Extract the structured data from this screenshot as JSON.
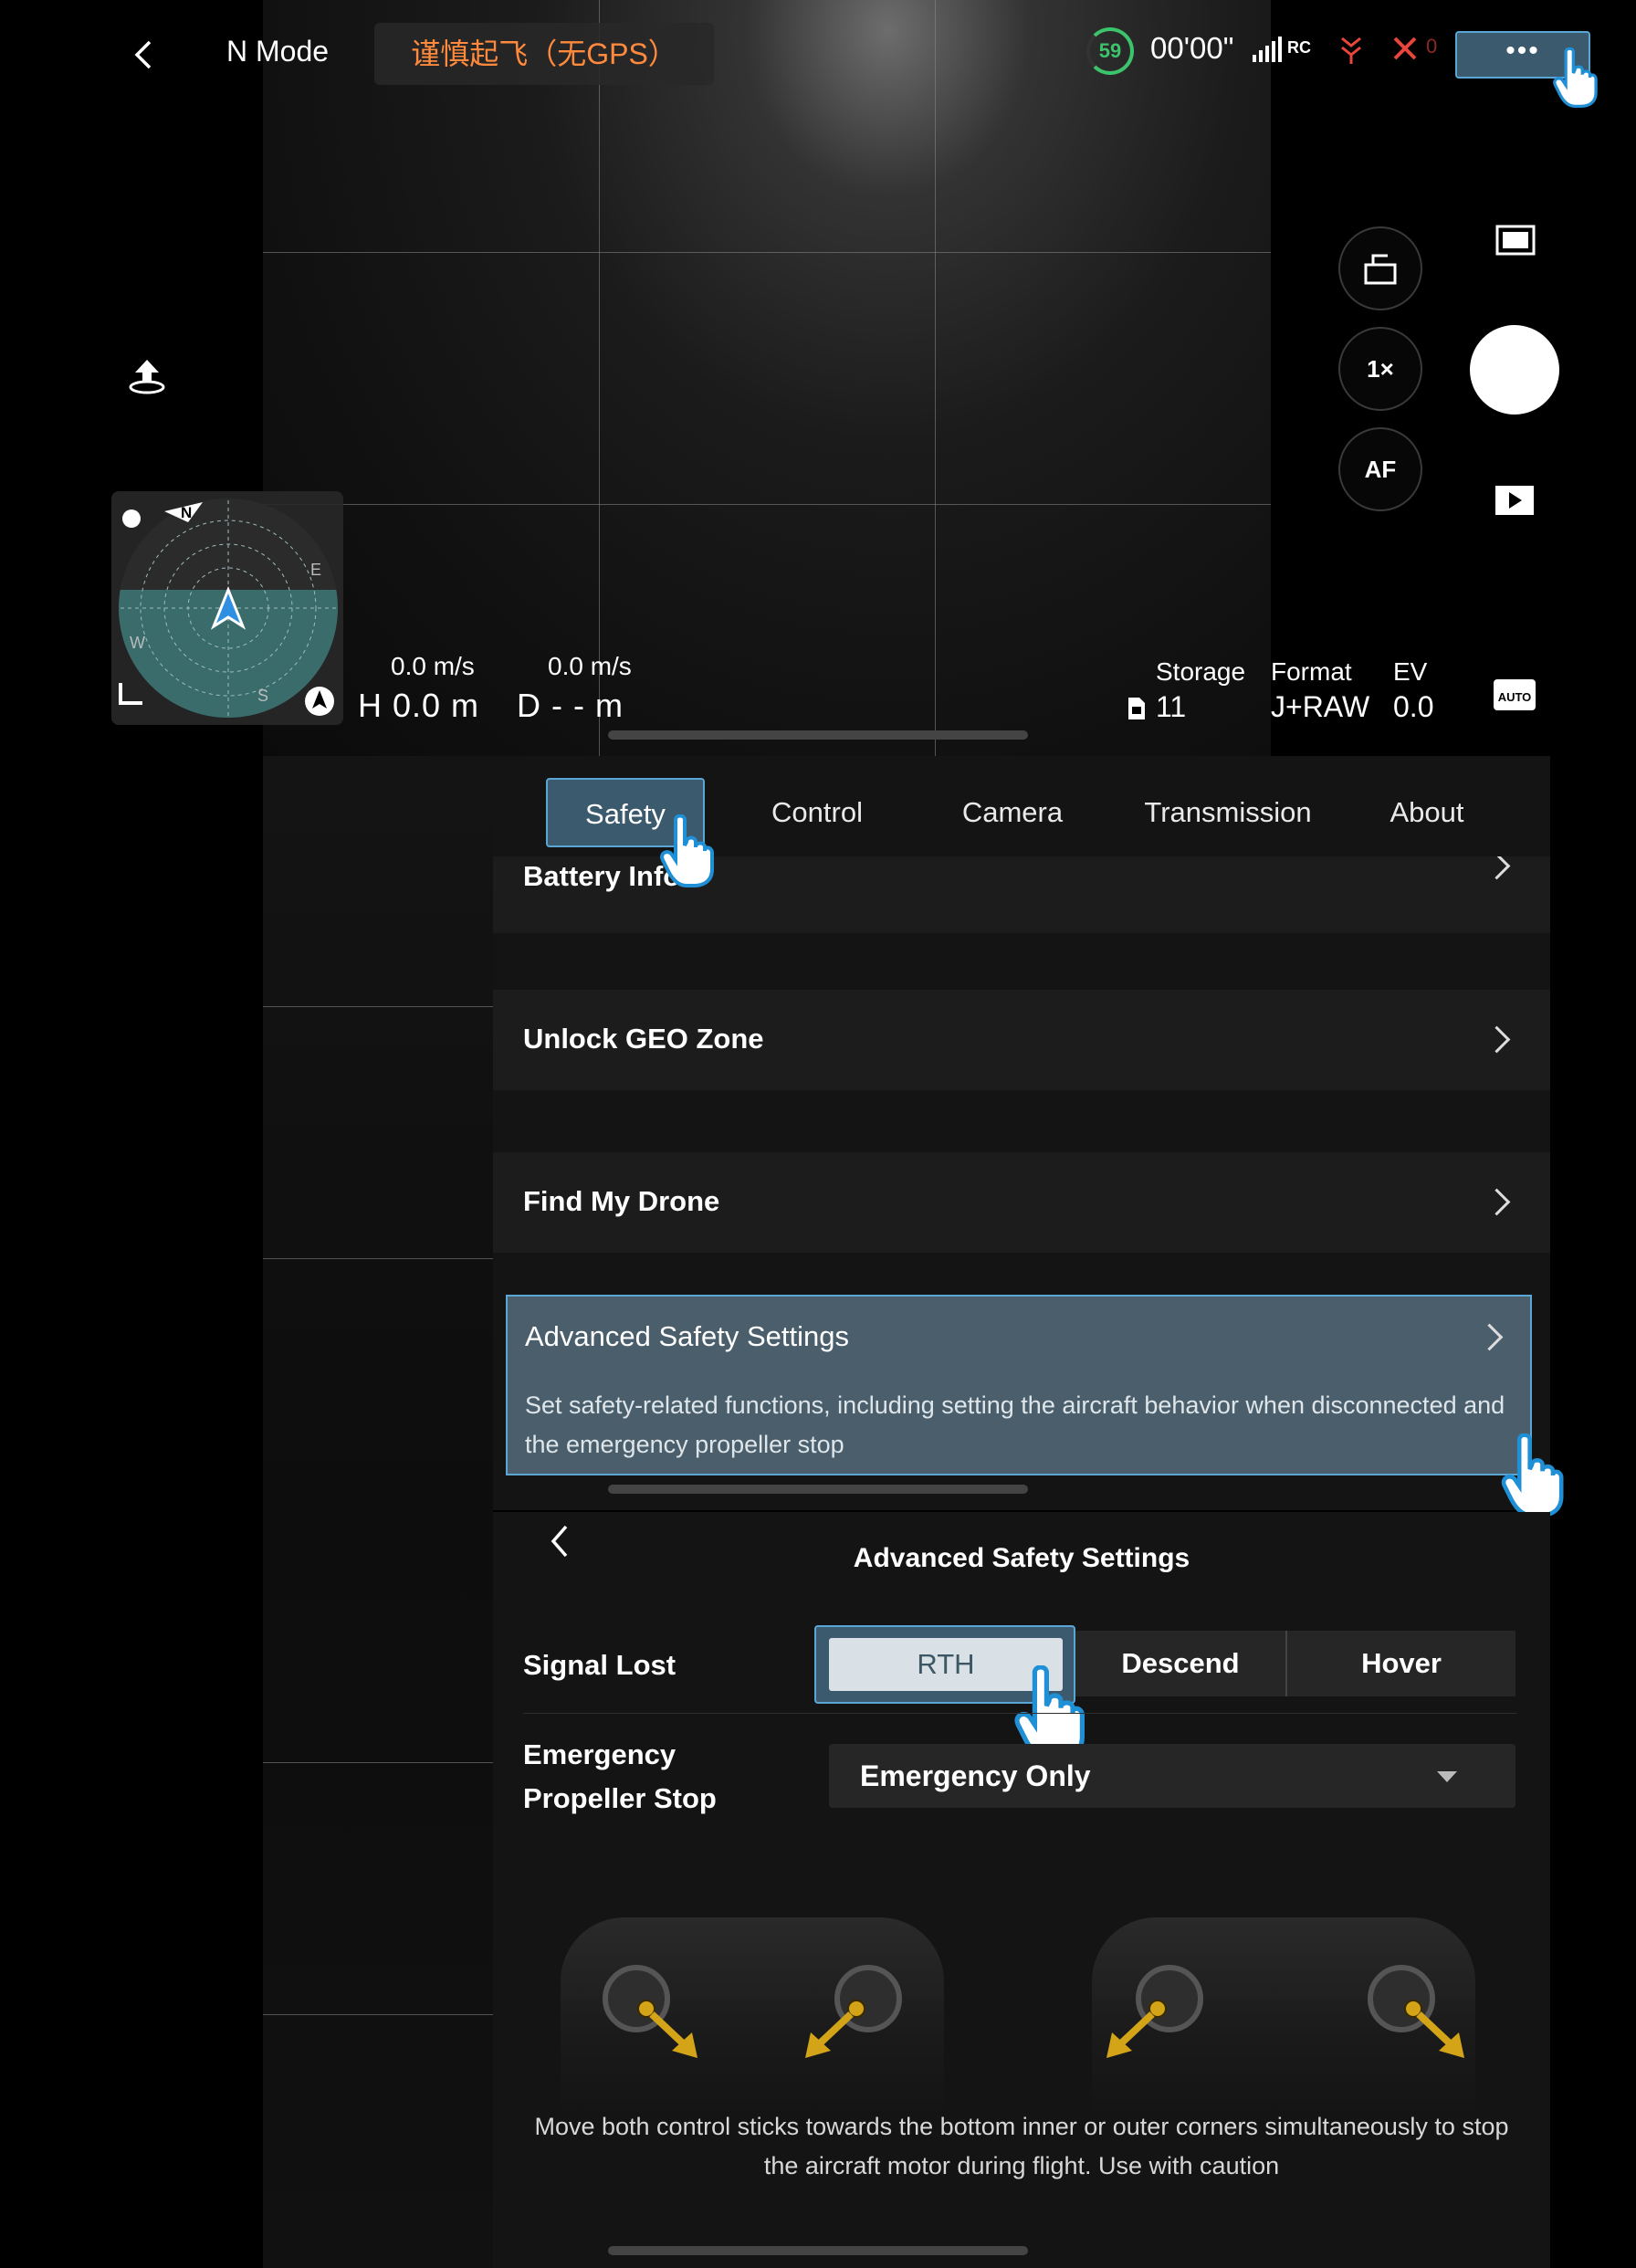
{
  "topbar": {
    "mode": "N Mode",
    "warning": "谨慎起飞（无GPS）",
    "battery": "59",
    "flight_time": "00'00\"",
    "signal_label": "RC",
    "motor_count": "0",
    "more": "•••"
  },
  "camera_controls": {
    "zoom": "1×",
    "focus": "AF",
    "auto_label": "AUTO"
  },
  "compass": {
    "n": "N",
    "e": "E",
    "s": "S",
    "w": "W"
  },
  "telemetry": {
    "h_speed": "0.0 m/s",
    "v_speed": "0.0 m/s",
    "height": "H 0.0 m",
    "distance": "D - - m"
  },
  "status": {
    "storage_label": "Storage",
    "storage_value": "11",
    "format_label": "Format",
    "format_value": "J+RAW",
    "ev_label": "EV",
    "ev_value": "0.0"
  },
  "settings": {
    "tabs": [
      "Safety",
      "Control",
      "Camera",
      "Transmission",
      "About"
    ],
    "partial_row": "Battery Info",
    "rows": [
      {
        "label": "Unlock GEO Zone"
      },
      {
        "label": "Find My Drone"
      }
    ],
    "advanced": {
      "title": "Advanced Safety Settings",
      "description": "Set safety-related functions, including setting the aircraft behavior when disconnected and the emergency propeller stop"
    }
  },
  "advanced_page": {
    "title": "Advanced Safety Settings",
    "signal_lost_label": "Signal Lost",
    "signal_lost_options": [
      "RTH",
      "Descend",
      "Hover"
    ],
    "signal_lost_selected": "RTH",
    "prop_stop_label_1": "Emergency",
    "prop_stop_label_2": "Propeller Stop",
    "prop_stop_value": "Emergency Only",
    "stick_description": "Move both control sticks towards the bottom inner or outer corners simultaneously to stop the aircraft motor during flight. Use with caution"
  },
  "colors": {
    "accent": "#5aa7d6",
    "selected_bg": "#3c5a6e",
    "warning": "#ff8a3d",
    "battery": "#3bc46b",
    "compass_fill": "#3a6c6c",
    "arrow": "#d4a418"
  }
}
